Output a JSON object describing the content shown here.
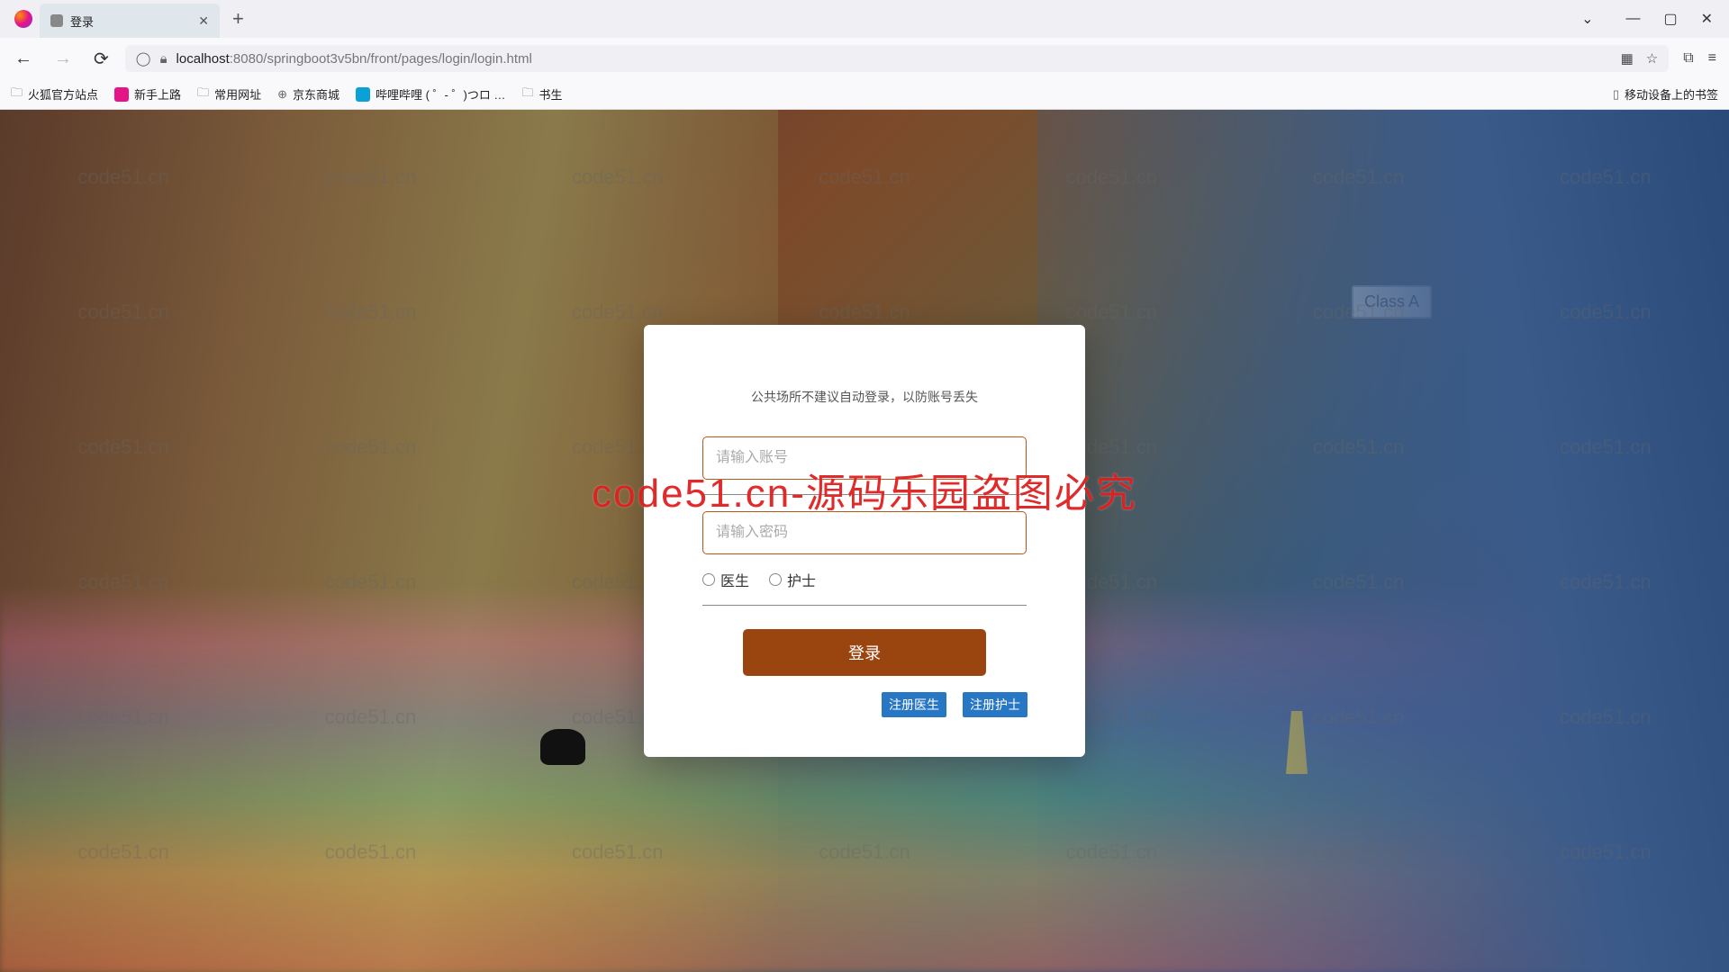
{
  "browser": {
    "tab_title": "登录",
    "url_host": "localhost",
    "url_port": ":8080",
    "url_path": "/springboot3v5bn/front/pages/login/login.html",
    "bookmarks": [
      "火狐官方站点",
      "新手上路",
      "常用网址",
      "京东商城",
      "哔哩哔哩 ( ゜- ゜)つロ …",
      "书生"
    ],
    "bookmarks_right": "移动设备上的书签"
  },
  "login": {
    "hint": "公共场所不建议自动登录，以防账号丢失",
    "username_placeholder": "请输入账号",
    "password_placeholder": "请输入密码",
    "role_options": {
      "doctor": "医生",
      "nurse": "护士"
    },
    "login_button": "登录",
    "register_doctor": "注册医生",
    "register_nurse": "注册护士"
  },
  "scene": {
    "class_sign": "Class A"
  },
  "watermark": {
    "small": "code51.cn",
    "big": "code51.cn-源码乐园盗图必究"
  }
}
